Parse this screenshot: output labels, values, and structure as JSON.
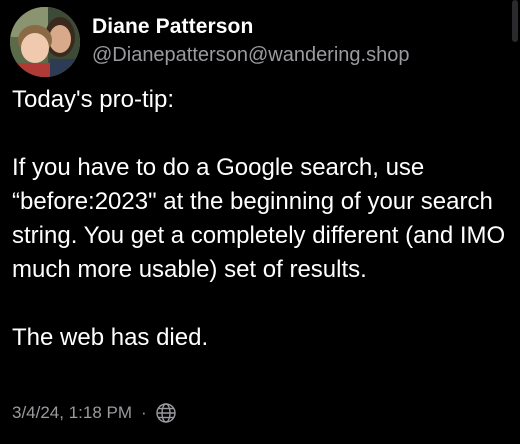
{
  "post": {
    "author": {
      "display_name": "Diane Patterson",
      "handle": "@Dianepatterson@wandering.shop",
      "avatar": "profile-photo-avatar"
    },
    "paragraphs": [
      "Today's pro-tip:",
      "If you have to do a Google search, use “before:2023\" at the beginning of your search string. You get a completely different (and IMO much more usable) set of results.",
      "The web has died."
    ],
    "timestamp": "3/4/24, 1:18 PM",
    "separator": "·",
    "visibility_icon": "globe-icon"
  },
  "colors": {
    "background": "#000000",
    "primary_text": "#ffffff",
    "secondary_text": "#9a9a9f"
  }
}
